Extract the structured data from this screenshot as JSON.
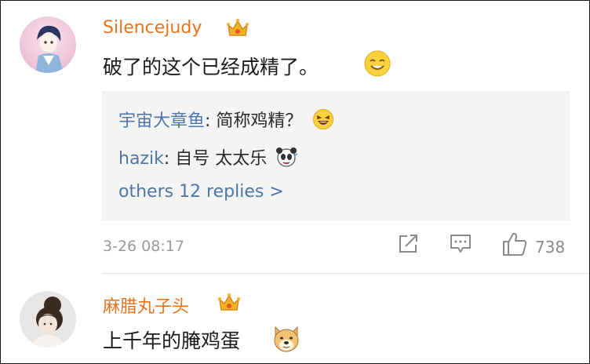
{
  "comments": [
    {
      "username": "Silencejudy",
      "text": "破了的这个已经成精了。",
      "emoji": "smile-emoji",
      "replies": [
        {
          "user": "宇宙大章鱼",
          "sep": ": ",
          "text": "简称鸡精？",
          "emoji": "laugh-emoji"
        },
        {
          "user": "hazik",
          "sep": ": ",
          "text": "自号 太太乐",
          "emoji": "panda-emoji"
        }
      ],
      "more_replies": "others 12 replies >",
      "time": "3-26 08:17",
      "like_count": "738"
    },
    {
      "username": "麻腊丸子头",
      "text": "上千年的腌鸡蛋",
      "emoji": "doge-emoji"
    }
  ],
  "icons": {
    "crown": "crown-icon",
    "share": "share-icon",
    "comment": "comment-icon",
    "like": "thumbs-up-icon"
  },
  "colors": {
    "username": "#e8731f",
    "reply_user": "#4f76a8",
    "reply_bg": "#f4f4f4",
    "meta": "#9a9a9a"
  }
}
